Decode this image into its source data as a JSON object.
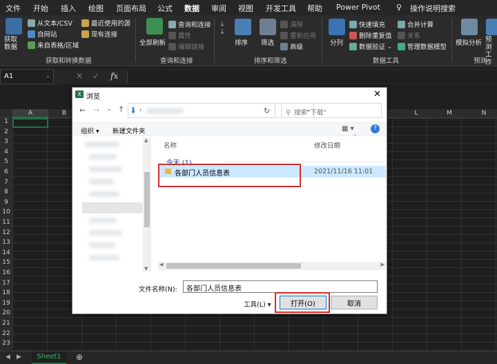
{
  "tabs": [
    "文件",
    "开始",
    "插入",
    "绘图",
    "页面布局",
    "公式",
    "数据",
    "审阅",
    "视图",
    "开发工具",
    "帮助",
    "Power Pivot",
    "操作说明搜索"
  ],
  "active_tab": "数据",
  "ribbon": {
    "get_data": "获取数据",
    "from_text_csv": "从文本/CSV",
    "from_web": "自网站",
    "from_table": "来自表格/区域",
    "recent_sources": "最近使用的源",
    "existing_connections": "现有连接",
    "group_get_transform": "获取和转换数据",
    "refresh_all": "全部刷新",
    "queries_connections": "查询和连接",
    "properties": "属性",
    "edit_links": "编辑链接",
    "group_queries": "查询和连接",
    "sort": "排序",
    "filter": "筛选",
    "clear": "清除",
    "reapply": "重新应用",
    "advanced": "高级",
    "group_sort_filter": "排序和筛选",
    "split": "分列",
    "flash_fill": "快速填充",
    "remove_duplicates": "删除重复值",
    "data_validation": "数据验证",
    "consolidate": "合并计算",
    "relationships": "关系",
    "manage_model": "管理数据模型",
    "group_data_tools": "数据工具",
    "what_if": "模拟分析",
    "forecast_sheet": "预测\n工作",
    "group_forecast": "预测"
  },
  "formula_bar": {
    "name_box": "A1",
    "fx": "fx"
  },
  "columns": [
    "A",
    "B",
    "L",
    "M",
    "N"
  ],
  "rows": [
    "1",
    "2",
    "3",
    "4",
    "5",
    "6",
    "7",
    "8",
    "9",
    "10",
    "11",
    "12",
    "13",
    "14",
    "15",
    "16",
    "17",
    "18",
    "19",
    "20",
    "21",
    "22",
    "23"
  ],
  "sheet_tab": "Sheet1",
  "dialog": {
    "title": "浏览",
    "search_placeholder": "搜索\"下载\"",
    "organize": "组织",
    "new_folder": "新建文件夹",
    "col_name": "名称",
    "col_modified": "修改日期",
    "group_today": "今天 (1)",
    "file_name": "各部门人员信息表",
    "file_date": "2021/11/16 11:01",
    "filename_label": "文件名称(N):",
    "filename_value": "各部门人员信息表",
    "tools": "工具(L)",
    "open": "打开(O)",
    "cancel": "取消"
  },
  "colors": {
    "excel_green": "#217346",
    "highlight_red": "#d42a2a",
    "selection_blue": "#cce8ff"
  }
}
